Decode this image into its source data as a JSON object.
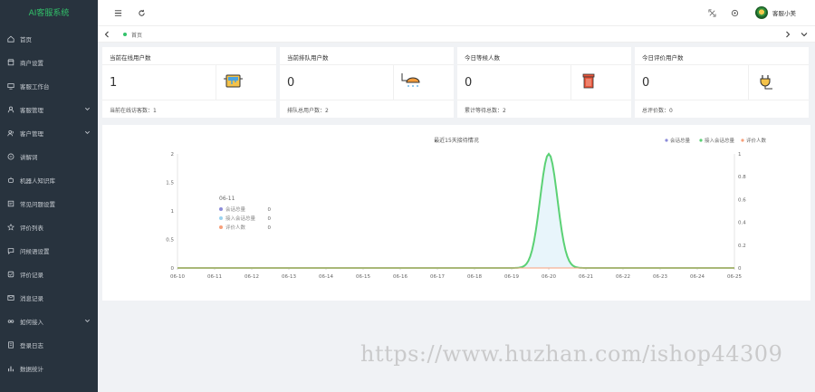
{
  "app": {
    "brand": "AI客服系统",
    "brand_color": "#32c26a",
    "sidebar_bg": "#28333e"
  },
  "sidebar": {
    "items": [
      {
        "label": "首页",
        "icon": "home-icon",
        "has_children": false
      },
      {
        "label": "商户设置",
        "icon": "store-icon",
        "has_children": false
      },
      {
        "label": "客服工作台",
        "icon": "workbench-icon",
        "has_children": false
      },
      {
        "label": "客服管理",
        "icon": "user-icon",
        "has_children": true
      },
      {
        "label": "客户管理",
        "icon": "customers-icon",
        "has_children": true
      },
      {
        "label": "讲解词",
        "icon": "speech-icon",
        "has_children": false
      },
      {
        "label": "机器人知识库",
        "icon": "robot-icon",
        "has_children": false
      },
      {
        "label": "常见问题设置",
        "icon": "faq-icon",
        "has_children": false
      },
      {
        "label": "评价列表",
        "icon": "star-icon",
        "has_children": false
      },
      {
        "label": "问候语设置",
        "icon": "greeting-icon",
        "has_children": false
      },
      {
        "label": "评价记录",
        "icon": "rating-icon",
        "has_children": false
      },
      {
        "label": "消息记录",
        "icon": "message-icon",
        "has_children": false
      },
      {
        "label": "如何接入",
        "icon": "connect-icon",
        "has_children": true
      },
      {
        "label": "登录日志",
        "icon": "log-icon",
        "has_children": false
      },
      {
        "label": "数据统计",
        "icon": "stats-icon",
        "has_children": false
      }
    ]
  },
  "header": {
    "menu_icon": "menu-toggle-icon",
    "refresh_icon": "refresh-icon",
    "fullscreen_icon": "fullscreen-icon",
    "theme_icon": "theme-icon",
    "username": "客服小美"
  },
  "tabs": {
    "home_label": "首页",
    "active_color": "#32c26a"
  },
  "cards": [
    {
      "title": "当前在线用户数",
      "value": "1",
      "footer": "当前在线访客数：1",
      "icon": "paint-bucket-icon"
    },
    {
      "title": "当前排队用户数",
      "value": "0",
      "footer": "排队总用户数：2",
      "icon": "shower-icon"
    },
    {
      "title": "今日等候人数",
      "value": "0",
      "footer": "累计等待总数：2",
      "icon": "trash-icon"
    },
    {
      "title": "今日评价用户数",
      "value": "0",
      "footer": "总评价数：0",
      "icon": "plug-icon"
    }
  ],
  "chart_data": {
    "type": "area",
    "title": "最近15天接待情况",
    "categories": [
      "06-10",
      "06-11",
      "06-12",
      "06-13",
      "06-14",
      "06-15",
      "06-16",
      "06-17",
      "06-18",
      "06-19",
      "06-20",
      "06-21",
      "06-22",
      "06-23",
      "06-24",
      "06-25"
    ],
    "series": [
      {
        "name": "会话总量",
        "color": "#8c8cd9",
        "values": [
          0,
          0,
          0,
          0,
          0,
          0,
          0,
          0,
          0,
          0,
          0,
          0,
          0,
          0,
          0,
          0
        ]
      },
      {
        "name": "接入会话总量",
        "color": "#5bd175",
        "values": [
          0,
          0,
          0,
          0,
          0,
          0,
          0,
          0,
          0,
          0,
          2,
          0,
          0,
          0,
          0,
          0
        ]
      },
      {
        "name": "评价人数",
        "color": "#f7a07b",
        "values": [
          0,
          0,
          0,
          0,
          0,
          0,
          0,
          0,
          0,
          0,
          0,
          0,
          0,
          0,
          0,
          0
        ]
      }
    ],
    "y_left": {
      "ticks": [
        "0",
        "0.5",
        "1",
        "1.5",
        "2"
      ],
      "range": [
        0,
        2
      ]
    },
    "y_right": {
      "ticks": [
        "0",
        "0.2",
        "0.4",
        "0.6",
        "0.8",
        "1"
      ],
      "range": [
        0,
        1
      ]
    },
    "legend_position": "top-right",
    "tooltip": {
      "date": "06-11",
      "rows": [
        {
          "name": "会话总量",
          "value": "0",
          "color": "#8c8cd9"
        },
        {
          "name": "接入会话总量",
          "value": "0",
          "color": "#9ad3f0"
        },
        {
          "name": "评价人数",
          "value": "0",
          "color": "#f7a07b"
        }
      ]
    }
  },
  "watermark": "https://www.huzhan.com/ishop44309"
}
